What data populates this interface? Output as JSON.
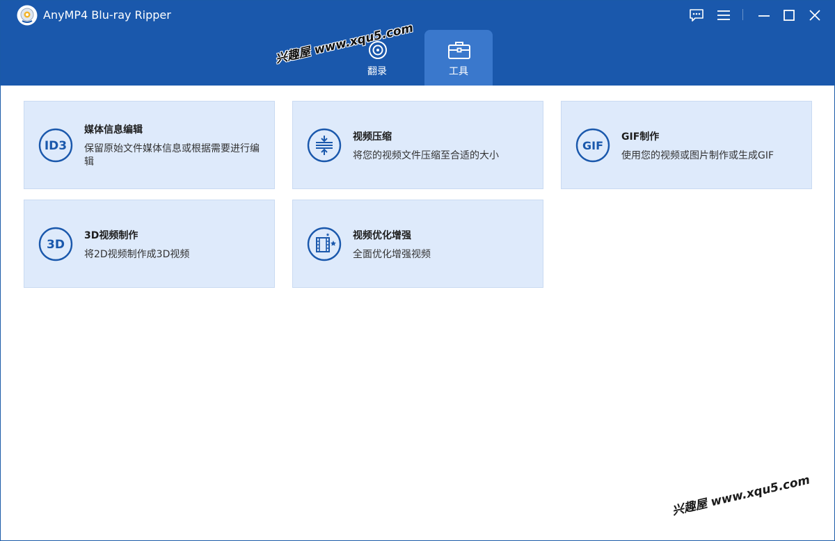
{
  "app": {
    "title": "AnyMP4 Blu-ray Ripper",
    "logo_icon": "disc-logo-icon"
  },
  "window_controls": [
    {
      "name": "feedback-icon"
    },
    {
      "name": "menu-icon"
    },
    {
      "name": "minimize-icon"
    },
    {
      "name": "maximize-icon"
    },
    {
      "name": "close-icon"
    }
  ],
  "tabs": [
    {
      "label": "翻录",
      "icon": "disc-ripper-icon",
      "active": false
    },
    {
      "label": "工具",
      "icon": "toolbox-icon",
      "active": true
    }
  ],
  "watermark": {
    "text": "兴趣屋 www.xqu5.com"
  },
  "tools": [
    {
      "title": "媒体信息编辑",
      "desc": "保留原始文件媒体信息或根据需要进行编辑",
      "icon": "id3-icon",
      "icon_text": "ID3"
    },
    {
      "title": "视频压缩",
      "desc": "将您的视频文件压缩至合适的大小",
      "icon": "compress-icon"
    },
    {
      "title": "GIF制作",
      "desc": "使用您的视频或图片制作或生成GIF",
      "icon": "gif-icon",
      "icon_text": "GIF"
    },
    {
      "title": "3D视频制作",
      "desc": "将2D视频制作成3D视频",
      "icon": "3d-icon",
      "icon_text": "3D"
    },
    {
      "title": "视频优化增强",
      "desc": "全面优化增强视频",
      "icon": "video-enhance-icon"
    }
  ],
  "colors": {
    "header": "#1a58ac",
    "active_tab": "#3a78cc",
    "card_bg": "#deeafb",
    "icon_blue": "#1a58ac"
  }
}
